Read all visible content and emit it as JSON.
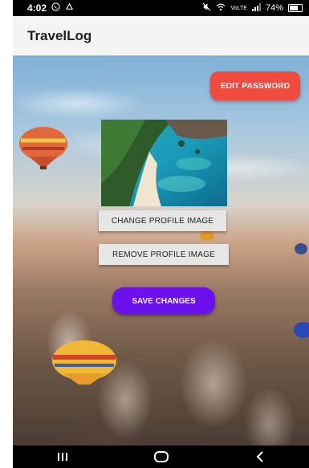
{
  "status_bar": {
    "time": "4:02",
    "left_icons": [
      "whatsapp-icon",
      "notification-icon"
    ],
    "right_icons": [
      "mute-icon",
      "wifi-icon",
      "volte-icon",
      "signal-icon"
    ],
    "network_label": "VoLTE",
    "battery": "74%"
  },
  "app_bar": {
    "title": "TravelLog"
  },
  "profile": {
    "edit_password_label": "EDIT PASSWORD",
    "change_image_label": "CHANGE PROFILE IMAGE",
    "remove_image_label": "REMOVE PROFILE IMAGE",
    "save_label": "SAVE CHANGES"
  },
  "nav": {
    "buttons": [
      "recents-icon",
      "home-icon",
      "back-icon"
    ]
  },
  "colors": {
    "edit_password": "#ef4b3f",
    "save_changes": "#6a11ee",
    "secondary_button": "#e6e6e6"
  }
}
